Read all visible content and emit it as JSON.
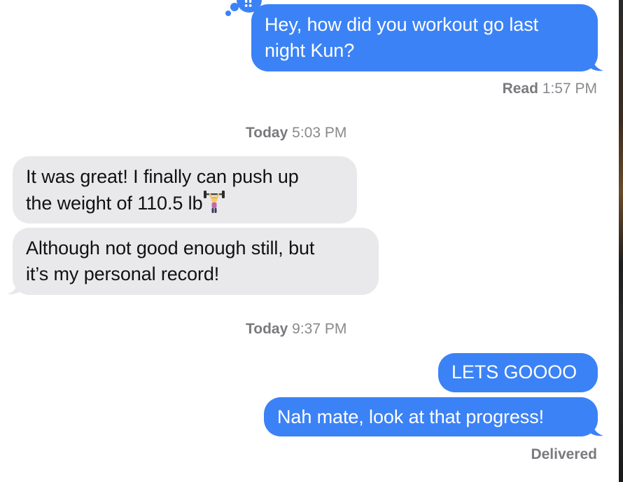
{
  "messages": {
    "m1": {
      "text_line1": "Hey, how did you workout go last",
      "text_line2": "night Kun?"
    },
    "read_receipt": {
      "label": "Read",
      "time": "1:57 PM"
    },
    "divider1": {
      "day": "Today",
      "time": "5:03 PM"
    },
    "m2": {
      "text_line1": "It was great! I finally can push up",
      "text_line2": "the weight of 110.5 lb"
    },
    "m3": {
      "text_line1": "Although not good enough still, but",
      "text_line2": "it’s my personal record!"
    },
    "divider2": {
      "day": "Today",
      "time": "9:37 PM"
    },
    "m4": {
      "text": "LETS GOOOO"
    },
    "m5": {
      "text": "Nah mate, look at that progress!"
    },
    "status": {
      "label": "Delivered"
    }
  },
  "icons": {
    "tapback": "exclamation-tapback-icon",
    "emoji": "weight-lifter-emoji"
  },
  "colors": {
    "sent_bubble": "#3b82f6",
    "received_bubble": "#e9e9eb",
    "meta_text": "#8a8a8e"
  }
}
